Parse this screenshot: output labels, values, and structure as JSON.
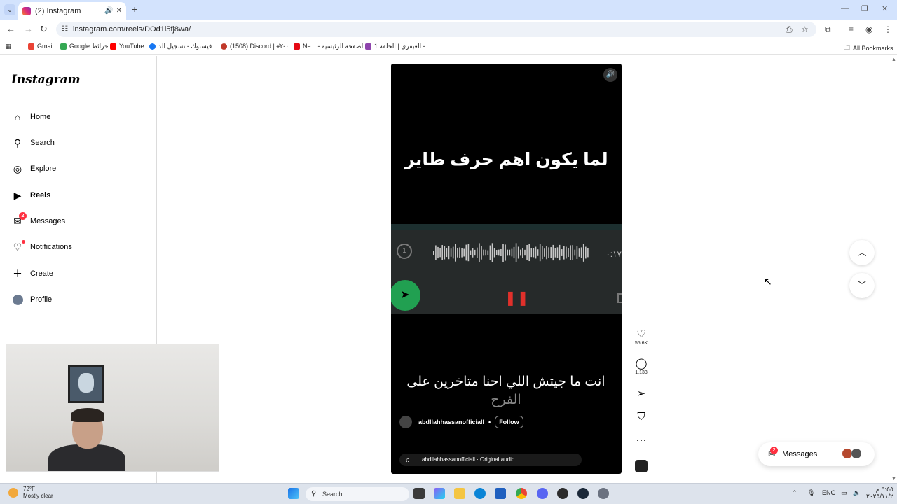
{
  "browser": {
    "tab_title": "(2) Instagram",
    "url": "instagram.com/reels/DOd1i5fj8wa/",
    "bookmarks": [
      {
        "label": "Gmail",
        "color": "#ea4335"
      },
      {
        "label": "Google خرائط",
        "color": "#34a853"
      },
      {
        "label": "YouTube",
        "color": "#ff0000"
      },
      {
        "label": "فيسبوك - تسجيل الد...",
        "color": "#1877f2"
      },
      {
        "label": "(1508) Discord | #٠-٢...",
        "color": "#c0392b"
      },
      {
        "label": "Ne... - الصفحة الرئيسية",
        "color": "#e50914"
      },
      {
        "label": "العبقري | الحلقة 1 -...",
        "color": "#8e44ad"
      }
    ],
    "all_bookmarks": "All Bookmarks"
  },
  "sidebar": {
    "logo": "Instagram",
    "items": [
      {
        "label": "Home",
        "icon": "home-icon"
      },
      {
        "label": "Search",
        "icon": "search-icon"
      },
      {
        "label": "Explore",
        "icon": "compass-icon"
      },
      {
        "label": "Reels",
        "icon": "reels-icon"
      },
      {
        "label": "Messages",
        "icon": "messenger-icon",
        "badge": "2"
      },
      {
        "label": "Notifications",
        "icon": "heart-icon"
      },
      {
        "label": "Create",
        "icon": "plus-icon"
      },
      {
        "label": "Profile",
        "icon": "avatar-icon"
      }
    ]
  },
  "reel": {
    "caption_top": "لما يكون اهم حرف طاير",
    "caption_emojis": "😂😂😂",
    "voice_speed": "1",
    "voice_duration": "٠:١٧",
    "caption_bottom_main": "انت ما جيتش اللي احنا متاخرين على",
    "caption_bottom_fade": "الفرح",
    "author": "abdllahhassanofficiall",
    "follow_label": "Follow",
    "post_emojis": "😂😂😂😂😂😂😂",
    "audio_label": "abdllahhassanofficiall · Original audio"
  },
  "actions": {
    "likes": "55.6K",
    "comments": "1,133"
  },
  "messages_pill": {
    "label": "Messages",
    "badge": "2"
  },
  "taskbar": {
    "temp": "72°F",
    "weather": "Mostly clear",
    "search": "Search",
    "lang": "ENG",
    "time": "٦:٥٥ م",
    "date": "٢٠٢٥/١١/٢"
  }
}
